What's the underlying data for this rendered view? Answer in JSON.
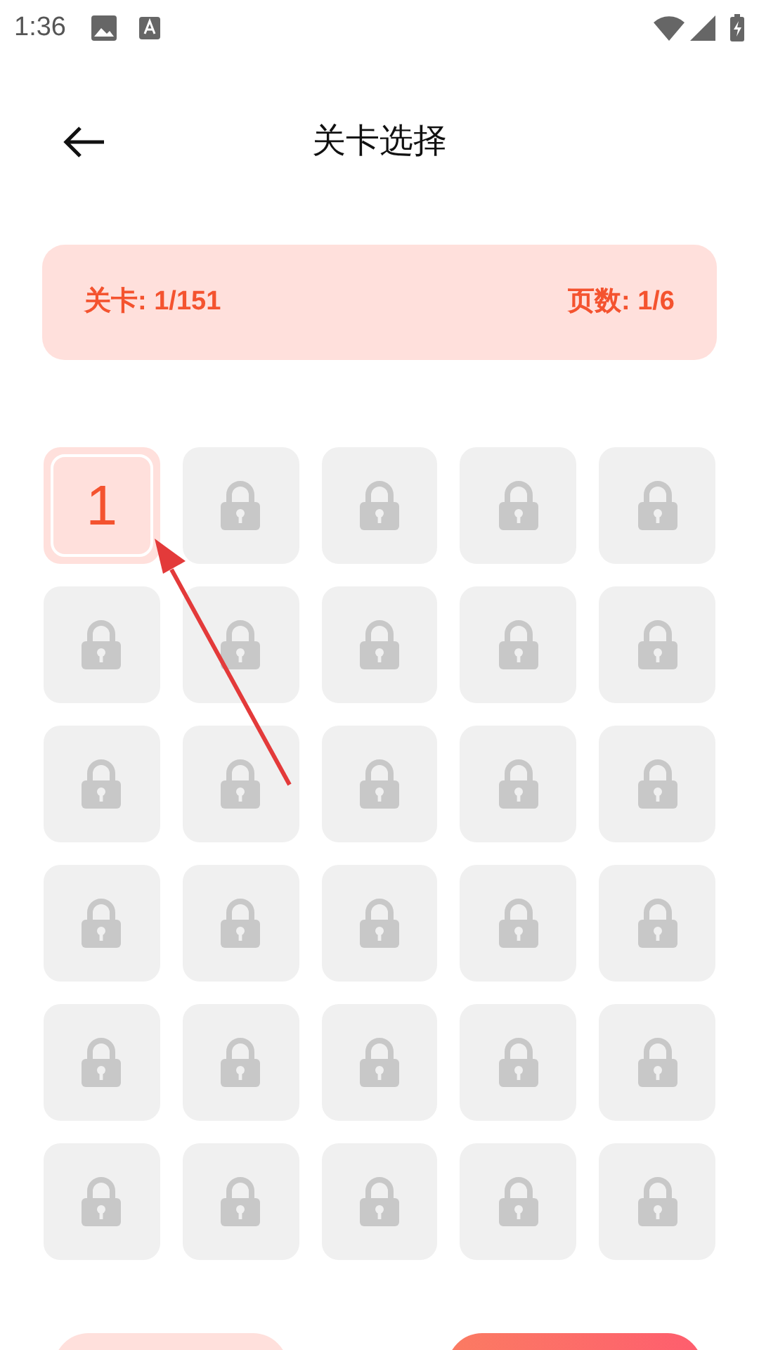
{
  "status_bar": {
    "time": "1:36"
  },
  "header": {
    "title": "关卡选择"
  },
  "info": {
    "level": "关卡: 1/151",
    "page": "页数: 1/6"
  },
  "levels": [
    {
      "locked": false,
      "label": "1"
    },
    {
      "locked": true
    },
    {
      "locked": true
    },
    {
      "locked": true
    },
    {
      "locked": true
    },
    {
      "locked": true
    },
    {
      "locked": true
    },
    {
      "locked": true
    },
    {
      "locked": true
    },
    {
      "locked": true
    },
    {
      "locked": true
    },
    {
      "locked": true
    },
    {
      "locked": true
    },
    {
      "locked": true
    },
    {
      "locked": true
    },
    {
      "locked": true
    },
    {
      "locked": true
    },
    {
      "locked": true
    },
    {
      "locked": true
    },
    {
      "locked": true
    },
    {
      "locked": true
    },
    {
      "locked": true
    },
    {
      "locked": true
    },
    {
      "locked": true
    },
    {
      "locked": true
    },
    {
      "locked": true
    },
    {
      "locked": true
    },
    {
      "locked": true
    },
    {
      "locked": true
    },
    {
      "locked": true
    }
  ],
  "bottom_buttons": [
    {
      "kind": "secondary"
    },
    {
      "kind": "primary"
    }
  ]
}
